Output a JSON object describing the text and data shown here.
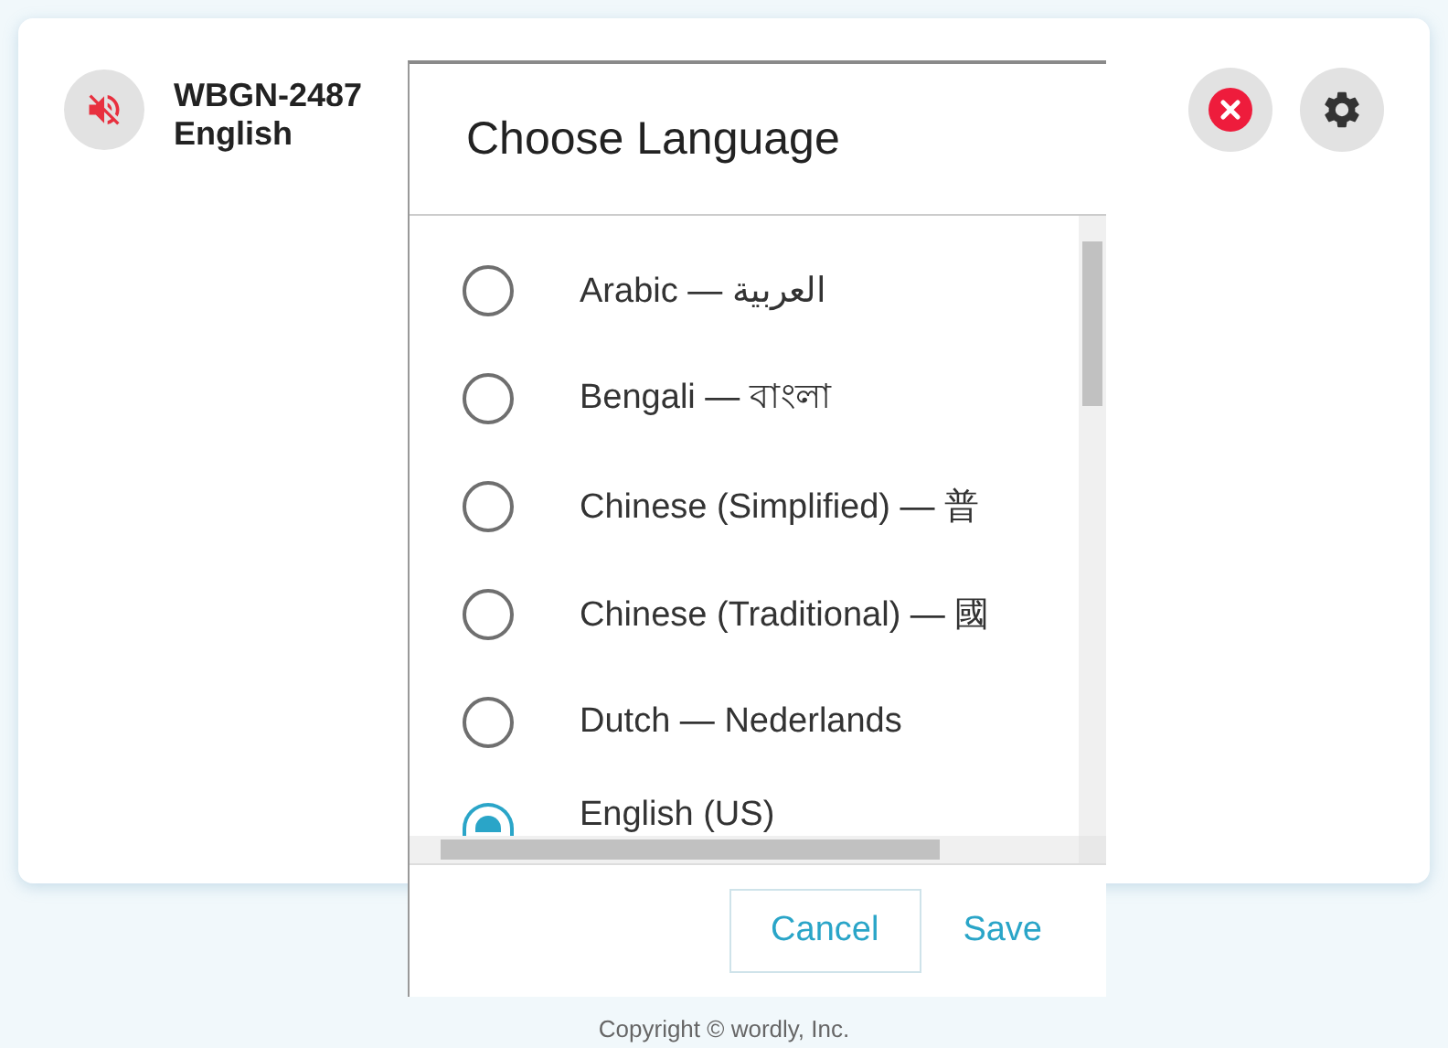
{
  "card": {
    "title": "WBGN-2487",
    "subtitle": "English"
  },
  "dialog": {
    "title": "Choose Language",
    "options": [
      {
        "label": "Arabic — العربية",
        "selected": false
      },
      {
        "label": "Bengali — বাংলা",
        "selected": false
      },
      {
        "label": "Chinese (Simplified) — 普",
        "selected": false
      },
      {
        "label": "Chinese (Traditional) — 國",
        "selected": false
      },
      {
        "label": "Dutch — Nederlands",
        "selected": false
      },
      {
        "label": "English (US)",
        "selected": true
      }
    ],
    "buttons": [
      {
        "label": "Cancel",
        "kind": "outlined"
      },
      {
        "label": "Save",
        "kind": "text"
      }
    ]
  },
  "footer": {
    "copyright": "Copyright © wordly, Inc."
  }
}
